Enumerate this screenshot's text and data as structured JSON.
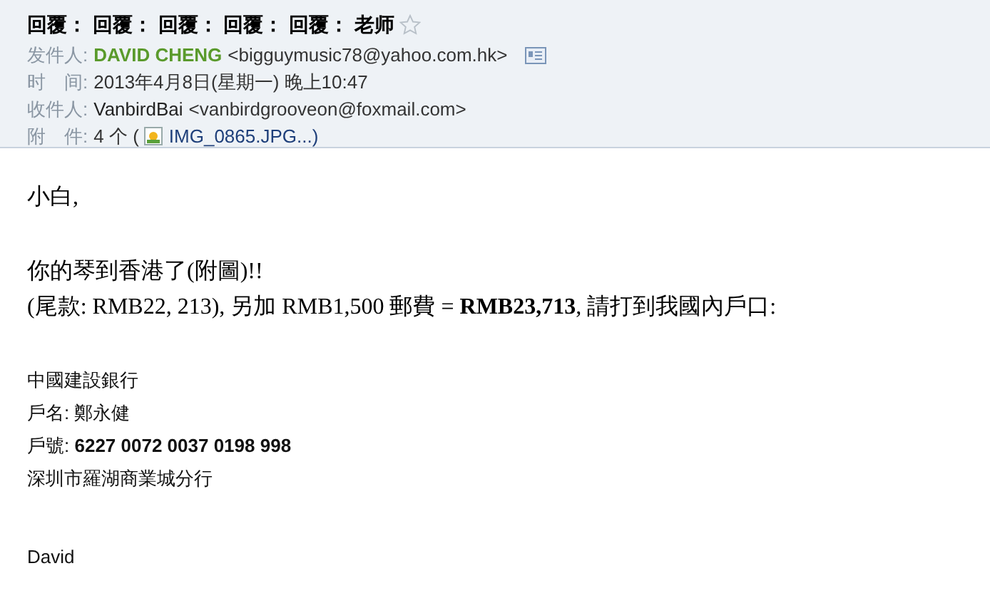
{
  "header": {
    "subject": "回覆： 回覆： 回覆： 回覆： 回覆： 老师",
    "starred": false,
    "sender": {
      "label": "发件人:",
      "name": "DAVID CHENG",
      "address": "<bigguymusic78@yahoo.com.hk>"
    },
    "time": {
      "label": "时　间:",
      "value": "2013年4月8日(星期一) 晚上10:47"
    },
    "recipient": {
      "label": "收件人:",
      "name": "VanbirdBai",
      "address": "<vanbirdgrooveon@foxmail.com>"
    },
    "attachments": {
      "label": "附　件:",
      "count": "4 个 (",
      "file": "IMG_0865.JPG...)"
    }
  },
  "body": [
    {
      "kind": "serif",
      "lines": [
        "小白,"
      ]
    },
    {
      "kind": "serif",
      "lines": [
        "你的琴到香港了(附圖)!!",
        "(尾款: RMB22, 213), 另加 RMB1,500 郵費 = **RMB23,713**, 請打到我國內戶口:"
      ]
    },
    {
      "kind": "sans",
      "lines": [
        "中國建設銀行",
        "戶名: 鄭永健",
        "戶號: **6227 0072 0037 0198 998**",
        "深圳市羅湖商業城分行"
      ]
    },
    {
      "kind": "sans",
      "lines": [
        "David"
      ]
    }
  ]
}
